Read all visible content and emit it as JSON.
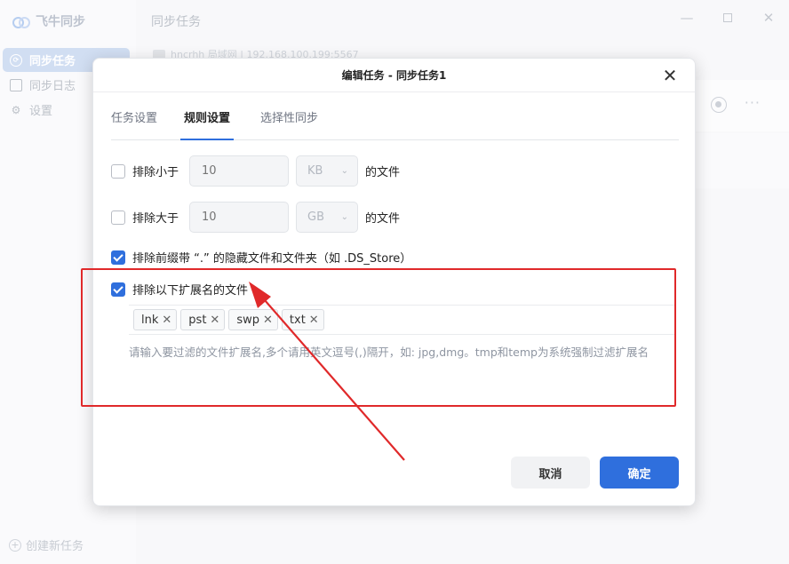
{
  "app": {
    "name": "飞牛同步",
    "nav": [
      {
        "label": "同步任务",
        "icon": "sync-circle-icon",
        "active": true
      },
      {
        "label": "同步日志",
        "icon": "log-icon",
        "active": false
      },
      {
        "label": "设置",
        "icon": "gear-icon",
        "active": false
      }
    ],
    "create_task": "创建新任务"
  },
  "main": {
    "title": "同步任务",
    "device_text": "hncrhh 局域网 | 192.168.100.199:5567"
  },
  "dialog": {
    "title": "编辑任务 - 同步任务1",
    "tabs": [
      {
        "label": "任务设置",
        "active": false
      },
      {
        "label": "规则设置",
        "active": true
      },
      {
        "label": "选择性同步",
        "active": false
      }
    ],
    "exclude_smaller": {
      "label": "排除小于",
      "checked": false,
      "value_placeholder": "10",
      "unit": "KB",
      "suffix": "的文件"
    },
    "exclude_larger": {
      "label": "排除大于",
      "checked": false,
      "value_placeholder": "10",
      "unit": "GB",
      "suffix": "的文件"
    },
    "exclude_hidden": {
      "label": "排除前缀带 “.” 的隐藏文件和文件夹（如 .DS_Store）",
      "checked": true
    },
    "exclude_ext": {
      "label": "排除以下扩展名的文件",
      "checked": true,
      "tags": [
        "lnk",
        "pst",
        "swp",
        "txt"
      ],
      "tag_remove_glyph": "✕",
      "hint": "请输入要过滤的文件扩展名,多个请用英文逗号(,)隔开，如: jpg,dmg。tmp和temp为系统强制过滤扩展名"
    },
    "cancel_label": "取消",
    "confirm_label": "确定"
  },
  "colors": {
    "accent": "#2f6fdd",
    "annotation": "#e0292a"
  }
}
